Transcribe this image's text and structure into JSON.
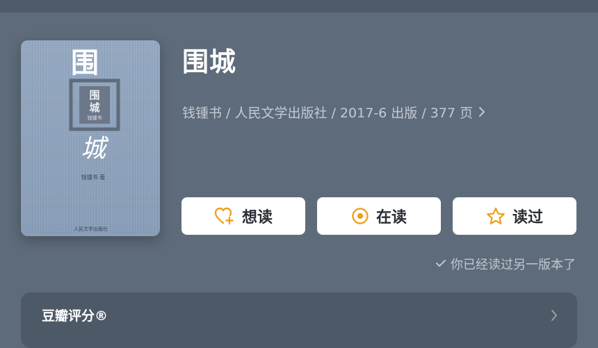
{
  "book": {
    "title": "围城",
    "meta_text": "钱锺书 / 人民文学出版社 / 2017-6 出版 / 377 页"
  },
  "cover": {
    "title_top": "围",
    "title_bottom": "城",
    "badge_top": "围",
    "badge_bottom": "城",
    "badge_caption": "钱锺书",
    "author_line": "钱锺书 著",
    "publisher_line": "人民文学出版社"
  },
  "actions": [
    {
      "label": "想读",
      "icon": "heart-plus-icon",
      "color": "#f0a020"
    },
    {
      "label": "在读",
      "icon": "radio-target-icon",
      "color": "#f0a020"
    },
    {
      "label": "读过",
      "icon": "star-icon",
      "color": "#f0a020"
    }
  ],
  "read_status": "你已经读过另一版本了",
  "rating_section": {
    "title": "豆瓣评分®"
  }
}
